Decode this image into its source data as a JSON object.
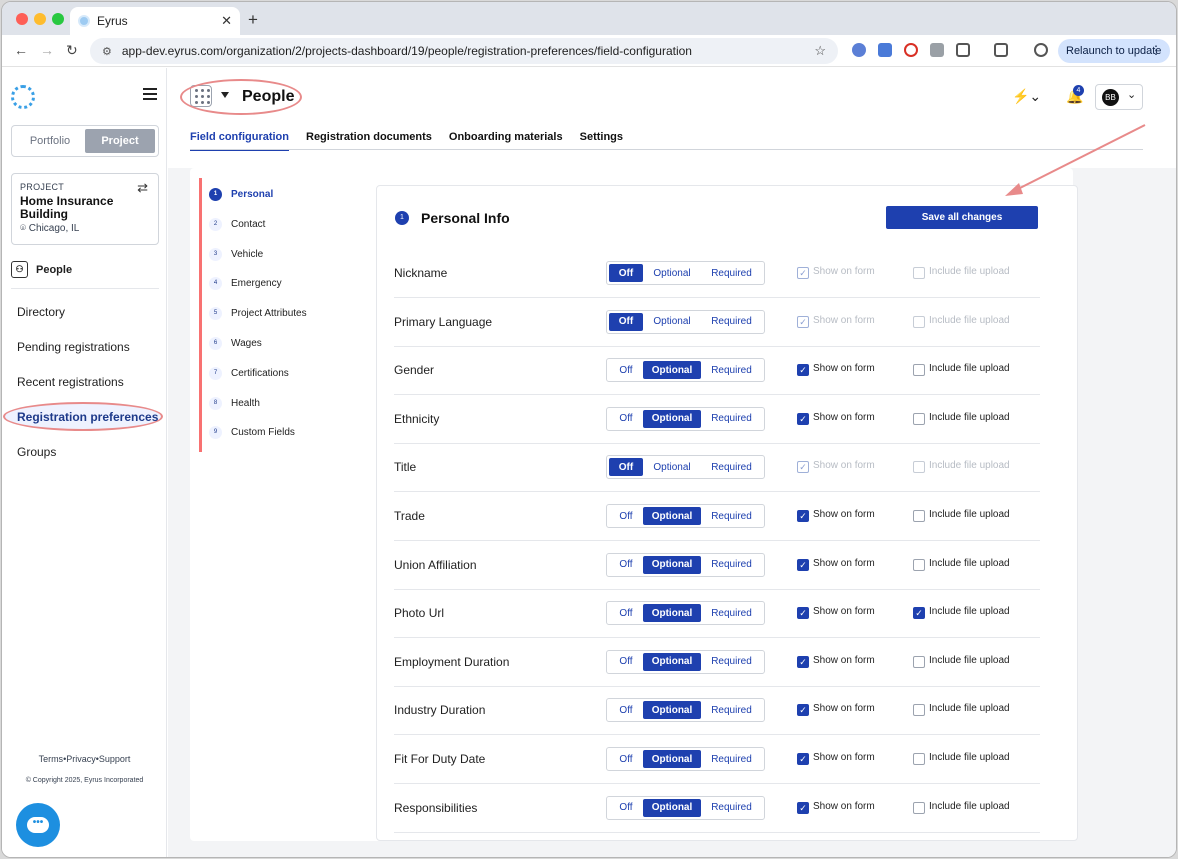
{
  "browser": {
    "tab_title": "Eyrus",
    "url": "app-dev.eyrus.com/organization/2/projects-dashboard/19/people/registration-preferences/field-configuration",
    "relaunch_label": "Relaunch to update"
  },
  "sidebar": {
    "toggle": {
      "portfolio": "Portfolio",
      "project": "Project"
    },
    "project_card": {
      "label": "PROJECT",
      "name": "Home Insurance Building",
      "location": "Chicago, IL"
    },
    "section_label": "People",
    "menu": [
      "Directory",
      "Pending registrations",
      "Recent registrations",
      "Registration preferences",
      "Groups"
    ],
    "active_menu": "Registration preferences",
    "footer": {
      "terms": "Terms",
      "privacy": "Privacy",
      "support": "Support",
      "copyright": "© Copyright 2025, Eyrus Incorporated"
    }
  },
  "header": {
    "title": "People",
    "notification_count": "4",
    "avatar_initials": "BB",
    "tabs": [
      "Field configuration",
      "Registration documents",
      "Onboarding materials",
      "Settings"
    ],
    "active_tab": "Field configuration"
  },
  "steps": [
    {
      "num": "1",
      "label": "Personal"
    },
    {
      "num": "2",
      "label": "Contact"
    },
    {
      "num": "3",
      "label": "Vehicle"
    },
    {
      "num": "4",
      "label": "Emergency"
    },
    {
      "num": "5",
      "label": "Project Attributes"
    },
    {
      "num": "6",
      "label": "Wages"
    },
    {
      "num": "7",
      "label": "Certifications"
    },
    {
      "num": "8",
      "label": "Health"
    },
    {
      "num": "9",
      "label": "Custom Fields"
    }
  ],
  "panel": {
    "num": "1",
    "title": "Personal Info",
    "save_label": "Save all changes",
    "option_labels": {
      "off": "Off",
      "optional": "Optional",
      "required": "Required"
    },
    "show_label": "Show on form",
    "upload_label": "Include file upload",
    "fields": [
      {
        "name": "Nickname",
        "mode": "Off",
        "show": true,
        "upload": false,
        "disabled": true
      },
      {
        "name": "Primary Language",
        "mode": "Off",
        "show": true,
        "upload": false,
        "disabled": true
      },
      {
        "name": "Gender",
        "mode": "Optional",
        "show": true,
        "upload": false,
        "disabled": false
      },
      {
        "name": "Ethnicity",
        "mode": "Optional",
        "show": true,
        "upload": false,
        "disabled": false
      },
      {
        "name": "Title",
        "mode": "Off",
        "show": true,
        "upload": false,
        "disabled": true
      },
      {
        "name": "Trade",
        "mode": "Optional",
        "show": true,
        "upload": false,
        "disabled": false
      },
      {
        "name": "Union Affiliation",
        "mode": "Optional",
        "show": true,
        "upload": false,
        "disabled": false
      },
      {
        "name": "Photo Url",
        "mode": "Optional",
        "show": true,
        "upload": true,
        "disabled": false
      },
      {
        "name": "Employment Duration",
        "mode": "Optional",
        "show": true,
        "upload": false,
        "disabled": false
      },
      {
        "name": "Industry Duration",
        "mode": "Optional",
        "show": true,
        "upload": false,
        "disabled": false
      },
      {
        "name": "Fit For Duty Date",
        "mode": "Optional",
        "show": true,
        "upload": false,
        "disabled": false
      },
      {
        "name": "Responsibilities",
        "mode": "Optional",
        "show": true,
        "upload": false,
        "disabled": false
      }
    ]
  },
  "colors": {
    "accent": "#1e40af",
    "annotation": "#e88a8a"
  }
}
